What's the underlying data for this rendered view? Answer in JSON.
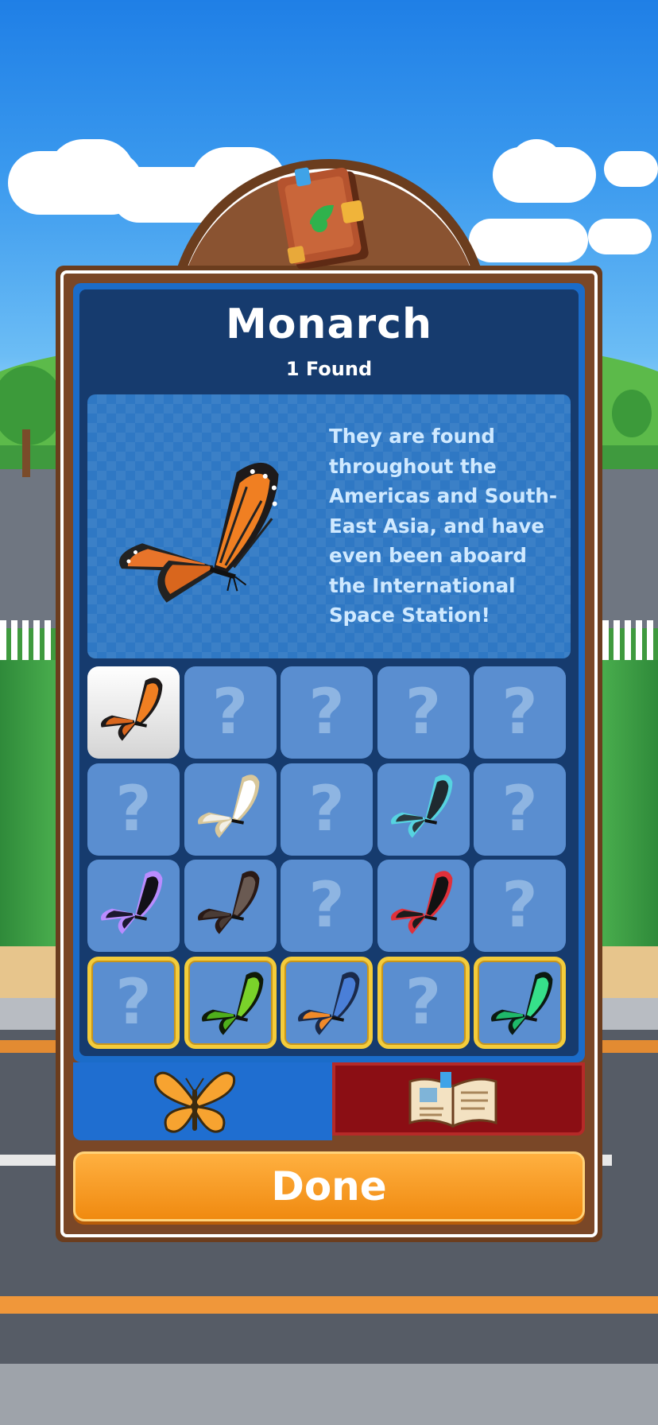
{
  "header": {
    "icon": "journal-book-icon",
    "title": "Monarch",
    "subtitle": "1 Found"
  },
  "info": {
    "image": "monarch-butterfly",
    "description": "They are found throughout the Americas and South-East Asia, and have even been aboard the International Space Station!"
  },
  "collection": {
    "placeholder": "?",
    "cells": [
      {
        "state": "found",
        "name": "monarch",
        "selected": true
      },
      {
        "state": "unknown"
      },
      {
        "state": "unknown"
      },
      {
        "state": "unknown"
      },
      {
        "state": "unknown"
      },
      {
        "state": "unknown"
      },
      {
        "state": "found",
        "name": "white"
      },
      {
        "state": "unknown"
      },
      {
        "state": "found",
        "name": "teal-black"
      },
      {
        "state": "unknown"
      },
      {
        "state": "found",
        "name": "purple-black"
      },
      {
        "state": "found",
        "name": "glasswing"
      },
      {
        "state": "unknown"
      },
      {
        "state": "found",
        "name": "red-black"
      },
      {
        "state": "unknown"
      },
      {
        "state": "unknown",
        "rare": true
      },
      {
        "state": "found",
        "name": "green-birdwing",
        "rare": true
      },
      {
        "state": "found",
        "name": "blue-orange",
        "rare": true
      },
      {
        "state": "unknown",
        "rare": true
      },
      {
        "state": "found",
        "name": "emerald-birdwing",
        "rare": true
      }
    ]
  },
  "tabs": [
    {
      "icon": "butterfly-icon",
      "active": true
    },
    {
      "icon": "open-book-icon",
      "active": false
    }
  ],
  "done_label": "Done",
  "colors": {
    "panel": "#163b6e",
    "frame": "#6b3d1e",
    "gold": "#f4cc3a",
    "done": "#f39a1f",
    "tab_red": "#8b0e14"
  }
}
